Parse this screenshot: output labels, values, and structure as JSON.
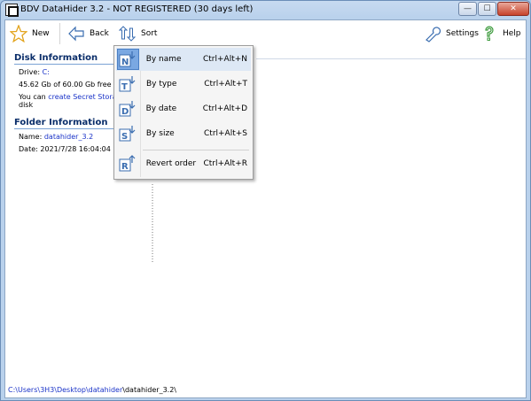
{
  "window": {
    "title": "BDV DataHider 3.2 - NOT REGISTERED (30 days left)",
    "min_glyph": "—",
    "max_glyph": "☐",
    "close_glyph": "✕"
  },
  "toolbar": {
    "new_label": "New",
    "back_label": "Back",
    "sort_label": "Sort",
    "settings_label": "Settings",
    "help_label": "Help"
  },
  "disk": {
    "title": "Disk Information",
    "drive_prefix": "Drive: ",
    "drive_value": "C:",
    "free_space": "45.62 Gb of 60.00 Gb free",
    "create_prefix": "You can ",
    "create_link": "create Secret Storage",
    "create_suffix": "disk"
  },
  "folder": {
    "title": "Folder Information",
    "name_prefix": "Name: ",
    "name_value": "datahider_3.2",
    "date_text": "Date: 2021/7/28 16:04:04"
  },
  "sort_menu": {
    "items": [
      {
        "label": "By name",
        "shortcut": "Ctrl+Alt+N",
        "icon": "sort-by-name-icon",
        "glyph": "N"
      },
      {
        "label": "By type",
        "shortcut": "Ctrl+Alt+T",
        "icon": "sort-by-type-icon",
        "glyph": "T"
      },
      {
        "label": "By date",
        "shortcut": "Ctrl+Alt+D",
        "icon": "sort-by-date-icon",
        "glyph": "D"
      },
      {
        "label": "By size",
        "shortcut": "Ctrl+Alt+S",
        "icon": "sort-by-size-icon",
        "glyph": "S"
      },
      {
        "label": "Revert order",
        "shortcut": "Ctrl+Alt+R",
        "icon": "revert-order-icon",
        "glyph": "R"
      }
    ]
  },
  "statusbar": {
    "path_link": "C:\\Users\\3H3\\Desktop\\datahider",
    "path_tail": "\\datahider_3.2\\"
  },
  "colors": {
    "accent": "#1a33c8",
    "section_title": "#0b2e6a",
    "menu_highlight": "#7aa8e2"
  }
}
